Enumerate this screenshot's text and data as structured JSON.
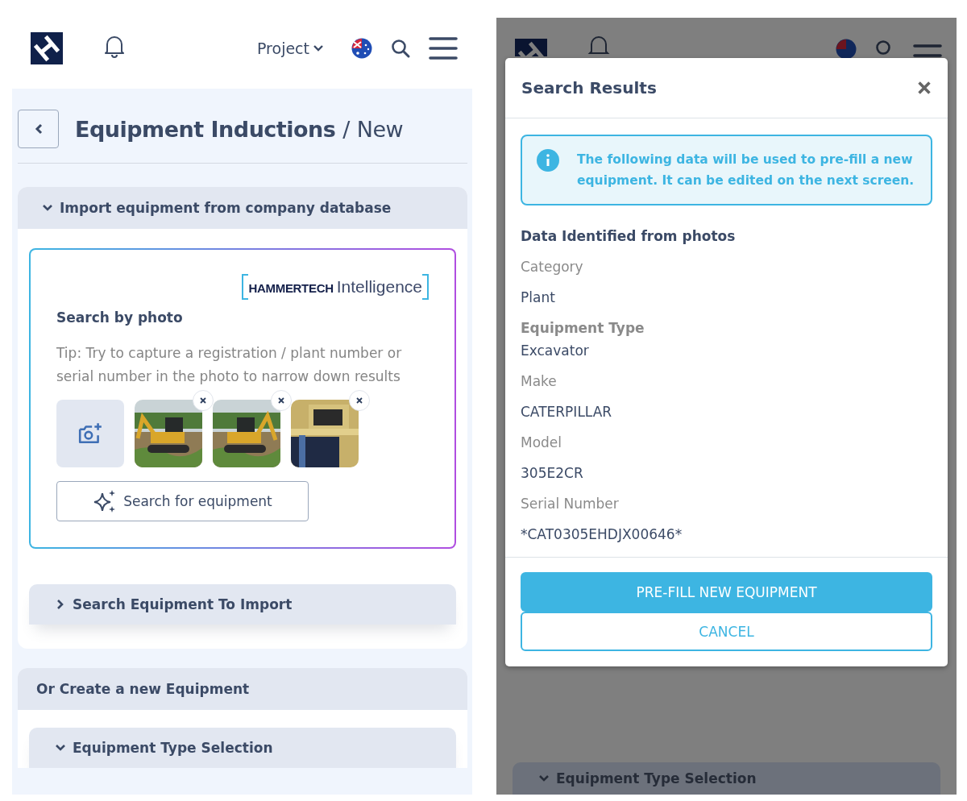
{
  "header": {
    "project_menu": "Project"
  },
  "page_title": {
    "title": "Equipment Inductions",
    "separator": "/",
    "subtitle": "New"
  },
  "import_section": {
    "title": "Import equipment from company database",
    "expanded": true,
    "brand": {
      "name": "HAMMERTECH",
      "suffix": "Intelligence"
    },
    "heading": "Search by photo",
    "tip": "Tip: Try to capture a registration / plant number or serial number in the photo to narrow down results",
    "search_button": "Search for equipment"
  },
  "search_import_section": {
    "title": "Search Equipment To Import",
    "expanded": false
  },
  "create_section": {
    "title": "Or Create a new Equipment",
    "subsections": [
      {
        "title": "Equipment Type Selection",
        "expanded": true
      }
    ]
  },
  "background_screen": {
    "bottom_section": {
      "title": "Equipment Type Selection",
      "expanded": true
    }
  },
  "modal": {
    "title": "Search Results",
    "info": "The following data will be used to pre-fill a new equipment. It can be edited on the next screen.",
    "section_title": "Data Identified from photos",
    "fields": [
      {
        "label": "Category",
        "value": "Plant",
        "bold_label": false
      },
      {
        "label": "Equipment Type",
        "value": "Excavator",
        "bold_label": true
      },
      {
        "label": "Make",
        "value": "CATERPILLAR",
        "bold_label": false
      },
      {
        "label": "Model",
        "value": "305E2CR",
        "bold_label": false
      },
      {
        "label": "Serial Number",
        "value": "*CAT0305EHDJX00646*",
        "bold_label": false
      }
    ],
    "buttons": [
      {
        "label": "PRE-FILL NEW EQUIPMENT",
        "kind": "primary"
      },
      {
        "label": "CANCEL",
        "kind": "secondary"
      }
    ]
  }
}
